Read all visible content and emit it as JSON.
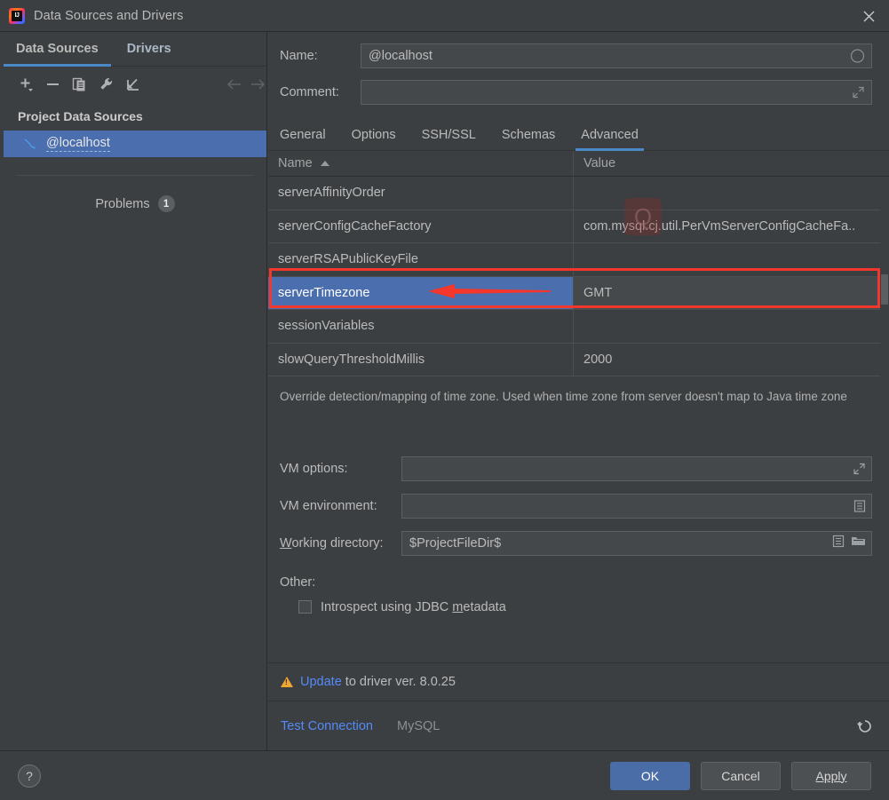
{
  "window": {
    "title": "Data Sources and Drivers",
    "app_icon": "intellij-idea-icon",
    "close_icon": "close-icon"
  },
  "left_pane": {
    "tabs": [
      {
        "label": "Data Sources",
        "active": true
      },
      {
        "label": "Drivers",
        "active": false
      }
    ],
    "toolbar": [
      {
        "name": "add-button",
        "icon": "plus-icon"
      },
      {
        "name": "remove-button",
        "icon": "minus-icon"
      },
      {
        "name": "duplicate-button",
        "icon": "copy-icon"
      },
      {
        "name": "properties-button",
        "icon": "wrench-icon"
      },
      {
        "name": "import-button",
        "icon": "import-arrow-icon"
      },
      {
        "name": "back-button",
        "icon": "arrow-left-icon"
      },
      {
        "name": "forward-button",
        "icon": "arrow-right-icon"
      }
    ],
    "section_title": "Project Data Sources",
    "data_source": {
      "label": "@localhost",
      "icon": "mysql-dolphin-icon",
      "selected": true
    },
    "problems": {
      "label": "Problems",
      "count": "1"
    }
  },
  "right_pane": {
    "name_field": {
      "label": "Name:",
      "value": "@localhost",
      "placeholder": "",
      "icon": "color-circle-icon"
    },
    "comment_field": {
      "label": "Comment:",
      "value": "",
      "placeholder": "",
      "icon": "expand-icon"
    },
    "detail_tabs": [
      {
        "label": "General",
        "active": false
      },
      {
        "label": "Options",
        "active": false
      },
      {
        "label": "SSH/SSL",
        "active": false
      },
      {
        "label": "Schemas",
        "active": false
      },
      {
        "label": "Advanced",
        "active": true
      }
    ],
    "table": {
      "columns": [
        "Name",
        "Value"
      ],
      "sort_column": "Name",
      "sort_direction": "ascending",
      "sort_icon": "sort-ascending-icon",
      "rows": [
        {
          "name": "serverAffinityOrder",
          "value": "",
          "selected": false
        },
        {
          "name": "serverConfigCacheFactory",
          "value": "com.mysql.cj.util.PerVmServerConfigCacheFa..",
          "selected": false
        },
        {
          "name": "serverRSAPublicKeyFile",
          "value": "",
          "selected": false
        },
        {
          "name": "serverTimezone",
          "value": "GMT",
          "selected": true
        },
        {
          "name": "sessionVariables",
          "value": "",
          "selected": false
        },
        {
          "name": "slowQueryThresholdMillis",
          "value": "2000",
          "selected": false
        }
      ]
    },
    "description": "Override detection/mapping of time zone. Used when time zone from server doesn't map to Java time zone",
    "vm_options": {
      "label": "VM options:",
      "value": "",
      "icon": "expand-icon"
    },
    "vm_environment": {
      "label": "VM environment:",
      "value": "",
      "icon": "list-icon"
    },
    "working_directory": {
      "label_prefix": "W",
      "label_rest": "orking directory:",
      "label": "Working directory:",
      "value": "$ProjectFileDir$",
      "icons": [
        "list-icon",
        "folder-icon"
      ]
    },
    "other": {
      "label": "Other:",
      "checkbox": {
        "label_before": "Introspect using JDBC ",
        "label_mnemonic": "m",
        "label_after": "etadata",
        "label": "Introspect using JDBC metadata",
        "checked": false
      }
    },
    "update_bar": {
      "warning_icon": "warning-triangle-icon",
      "link_text": "Update",
      "rest_text": " to driver ver. 8.0.25"
    },
    "connection_bar": {
      "test_connection": "Test Connection",
      "driver": "MySQL",
      "revert_icon": "revert-icon"
    }
  },
  "bottom_bar": {
    "help_label": "?",
    "help_icon": "help-icon",
    "buttons": [
      {
        "label": "OK",
        "primary": true
      },
      {
        "label": "Cancel",
        "primary": false
      },
      {
        "label": "Apply",
        "primary": false,
        "mnemonic": "A"
      }
    ]
  },
  "annotation": {
    "type": "red-arrow-highlight",
    "color": "#f4372c",
    "target": "serverTimezone row value GMT"
  },
  "colors": {
    "accent": "#4a88c7",
    "selection": "#4b6eaf",
    "link": "#548af7",
    "warning": "#f0a732",
    "annotation_red": "#f4372c",
    "window_bg": "#3c3f41",
    "field_bg": "#45484a"
  }
}
